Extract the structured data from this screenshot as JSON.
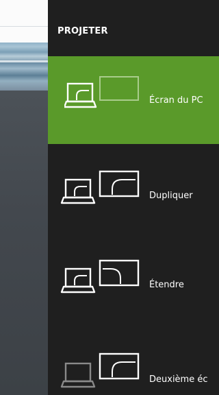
{
  "panel": {
    "title": "PROJETER",
    "options": [
      {
        "label": "Écran du PC",
        "icon": "pc-screen-only-icon",
        "selected": true
      },
      {
        "label": "Dupliquer",
        "icon": "duplicate-icon",
        "selected": false
      },
      {
        "label": "Étendre",
        "icon": "extend-icon",
        "selected": false
      },
      {
        "label": "Deuxième éc",
        "icon": "second-screen-only-icon",
        "selected": false
      }
    ]
  },
  "colors": {
    "panel_bg": "#1f1f1f",
    "selected_bg": "#5a9a2a",
    "text": "#ffffff",
    "dim_icon": "#8a8a8a"
  }
}
